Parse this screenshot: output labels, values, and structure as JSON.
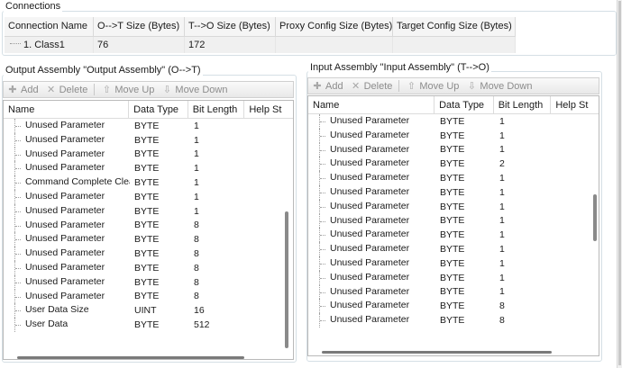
{
  "connections": {
    "title": "Connections",
    "columns": [
      "Connection Name",
      "O-->T Size (Bytes)",
      "T-->O Size (Bytes)",
      "Proxy Config Size (Bytes)",
      "Target Config Size (Bytes)"
    ],
    "rows": [
      {
        "name": "1. Class1",
        "ot_size": "76",
        "to_size": "172",
        "proxy": "",
        "target": ""
      }
    ]
  },
  "output_assembly": {
    "title": "Output Assembly \"Output Assembly\" (O-->T)",
    "toolbar": {
      "add": "Add",
      "delete": "Delete",
      "move_up": "Move Up",
      "move_down": "Move Down"
    },
    "columns": [
      "Name",
      "Data Type",
      "Bit Length",
      "Help St"
    ],
    "rows": [
      {
        "name": "Unused Parameter",
        "type": "BYTE",
        "bits": "1"
      },
      {
        "name": "Unused Parameter",
        "type": "BYTE",
        "bits": "1"
      },
      {
        "name": "Unused Parameter",
        "type": "BYTE",
        "bits": "1"
      },
      {
        "name": "Unused Parameter",
        "type": "BYTE",
        "bits": "1"
      },
      {
        "name": "Command Complete Clear",
        "type": "BYTE",
        "bits": "1"
      },
      {
        "name": "Unused Parameter",
        "type": "BYTE",
        "bits": "1"
      },
      {
        "name": "Unused Parameter",
        "type": "BYTE",
        "bits": "1"
      },
      {
        "name": "Unused Parameter",
        "type": "BYTE",
        "bits": "8"
      },
      {
        "name": "Unused Parameter",
        "type": "BYTE",
        "bits": "8"
      },
      {
        "name": "Unused Parameter",
        "type": "BYTE",
        "bits": "8"
      },
      {
        "name": "Unused Parameter",
        "type": "BYTE",
        "bits": "8"
      },
      {
        "name": "Unused Parameter",
        "type": "BYTE",
        "bits": "8"
      },
      {
        "name": "Unused Parameter",
        "type": "BYTE",
        "bits": "8"
      },
      {
        "name": "User Data Size",
        "type": "UINT",
        "bits": "16"
      },
      {
        "name": "User Data",
        "type": "BYTE",
        "bits": "512"
      }
    ]
  },
  "input_assembly": {
    "title": "Input Assembly \"Input Assembly\" (T-->O)",
    "toolbar": {
      "add": "Add",
      "delete": "Delete",
      "move_up": "Move Up",
      "move_down": "Move Down"
    },
    "columns": [
      "Name",
      "Data Type",
      "Bit Length",
      "Help St"
    ],
    "rows": [
      {
        "name": "Unused Parameter",
        "type": "BYTE",
        "bits": "1"
      },
      {
        "name": "Unused Parameter",
        "type": "BYTE",
        "bits": "1"
      },
      {
        "name": "Unused Parameter",
        "type": "BYTE",
        "bits": "1"
      },
      {
        "name": "Unused Parameter",
        "type": "BYTE",
        "bits": "2"
      },
      {
        "name": "Unused Parameter",
        "type": "BYTE",
        "bits": "1"
      },
      {
        "name": "Unused Parameter",
        "type": "BYTE",
        "bits": "1"
      },
      {
        "name": "Unused Parameter",
        "type": "BYTE",
        "bits": "1"
      },
      {
        "name": "Unused Parameter",
        "type": "BYTE",
        "bits": "1"
      },
      {
        "name": "Unused Parameter",
        "type": "BYTE",
        "bits": "1"
      },
      {
        "name": "Unused Parameter",
        "type": "BYTE",
        "bits": "1"
      },
      {
        "name": "Unused Parameter",
        "type": "BYTE",
        "bits": "1"
      },
      {
        "name": "Unused Parameter",
        "type": "BYTE",
        "bits": "1"
      },
      {
        "name": "Unused Parameter",
        "type": "BYTE",
        "bits": "1"
      },
      {
        "name": "Unused Parameter",
        "type": "BYTE",
        "bits": "8"
      },
      {
        "name": "Unused Parameter",
        "type": "BYTE",
        "bits": "8"
      }
    ]
  },
  "icons": {
    "add": "plus-icon",
    "delete": "x-icon",
    "move_up": "arrow-up-icon",
    "move_down": "arrow-down-icon"
  },
  "colors": {
    "group_border": "#d5dfe5",
    "toolbar_text_disabled": "#8c8c8c",
    "row_selected_bg": "#f0f0f0"
  }
}
